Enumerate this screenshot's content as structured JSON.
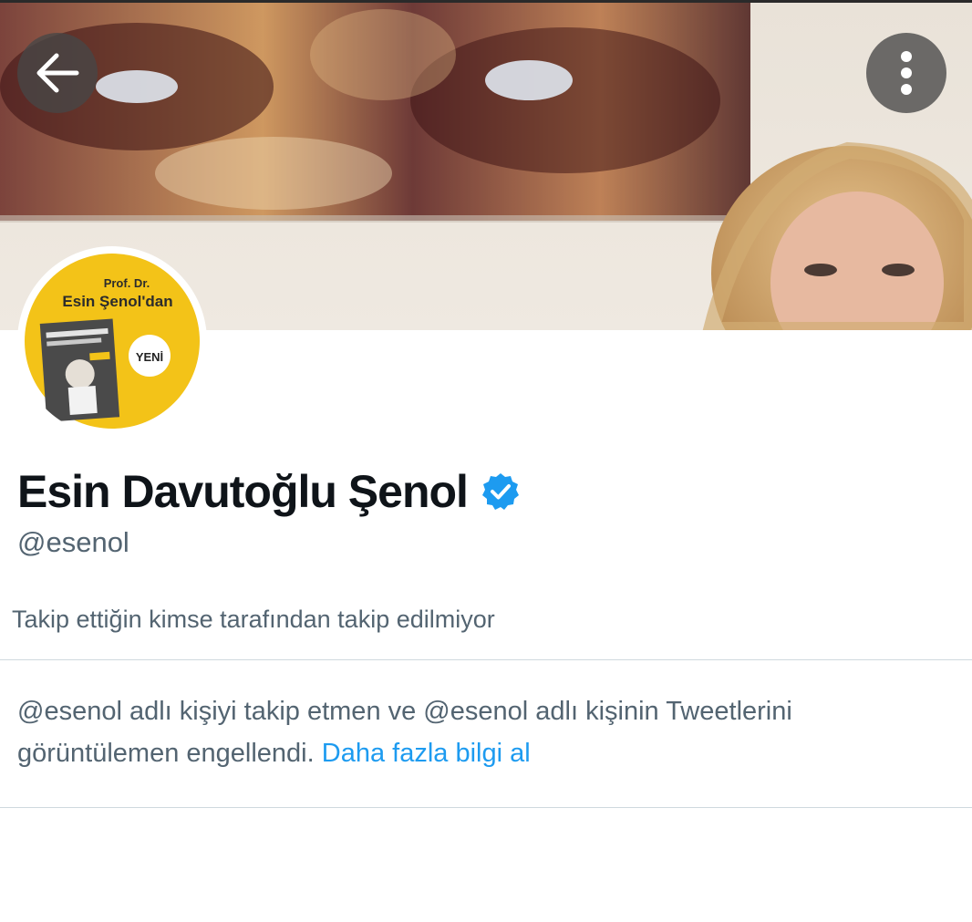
{
  "header": {
    "back_icon": "arrow-left-icon",
    "more_icon": "vertical-dots-icon"
  },
  "avatar": {
    "line1": "Prof. Dr.",
    "line2": "Esin Şenol'dan",
    "badge": "YENİ"
  },
  "profile": {
    "display_name": "Esin Davutoğlu Şenol",
    "verified_icon": "verified-badge-icon",
    "handle": "@esenol",
    "follow_context": "Takip ettiğin kimse tarafından takip edilmiyor"
  },
  "blocked": {
    "message": "@esenol adlı kişiyi takip etmen ve @esenol adlı kişinin Tweetlerini görüntülemen engellendi. ",
    "link_label": "Daha fazla bilgi al"
  },
  "colors": {
    "accent": "#1d9bf0",
    "verified": "#1d9bf0",
    "text_primary": "#0f1419",
    "text_secondary": "#536471",
    "avatar_yellow": "#f3c318"
  }
}
